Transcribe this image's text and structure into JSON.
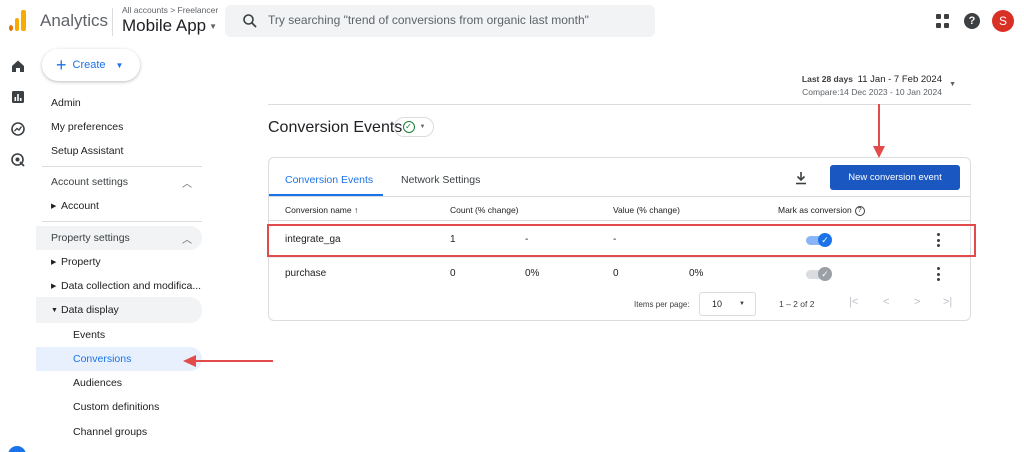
{
  "header": {
    "app_name": "Analytics",
    "account_crumb": "All accounts > Freelancer",
    "property_name": "Mobile App",
    "search_placeholder": "Try searching \"trend of conversions from organic last month\"",
    "avatar_initial": "S",
    "help_label": "?"
  },
  "sidebar": {
    "create_label": "Create",
    "admin": "Admin",
    "my_preferences": "My preferences",
    "setup_assistant": "Setup Assistant",
    "account_settings": "Account settings",
    "account": "Account",
    "property_settings": "Property settings",
    "property": "Property",
    "data_collection": "Data collection and modifica...",
    "data_display": "Data display",
    "children": [
      "Events",
      "Conversions",
      "Audiences",
      "Custom definitions",
      "Channel groups"
    ],
    "active_child": "Conversions"
  },
  "date": {
    "label": "Last 28 days",
    "range": "11 Jan - 7 Feb 2024",
    "compare": "Compare:14 Dec 2023 - 10 Jan 2024"
  },
  "page": {
    "title": "Conversion Events",
    "tabs": [
      "Conversion Events",
      "Network Settings"
    ],
    "active_tab": "Conversion Events",
    "new_button": "New conversion event"
  },
  "table": {
    "columns": [
      "Conversion name ↑",
      "Count (% change)",
      "Value (% change)",
      "Mark as conversion"
    ],
    "rows": [
      {
        "name": "integrate_ga",
        "count": "1",
        "count_change": "-",
        "value": "-",
        "value_change": "",
        "marked": true
      },
      {
        "name": "purchase",
        "count": "0",
        "count_change": "0%",
        "value": "0",
        "value_change": "0%",
        "marked": true
      }
    ]
  },
  "pager": {
    "items_label": "Items per page:",
    "items_value": "10",
    "range": "1 – 2 of 2"
  },
  "colors": {
    "accent": "#1a73e8",
    "primary_button": "#1a57c0",
    "annotation_red": "#e34a4a",
    "toggle_on": "#1a73e8",
    "toggle_disabled": "#9aa0a6"
  }
}
